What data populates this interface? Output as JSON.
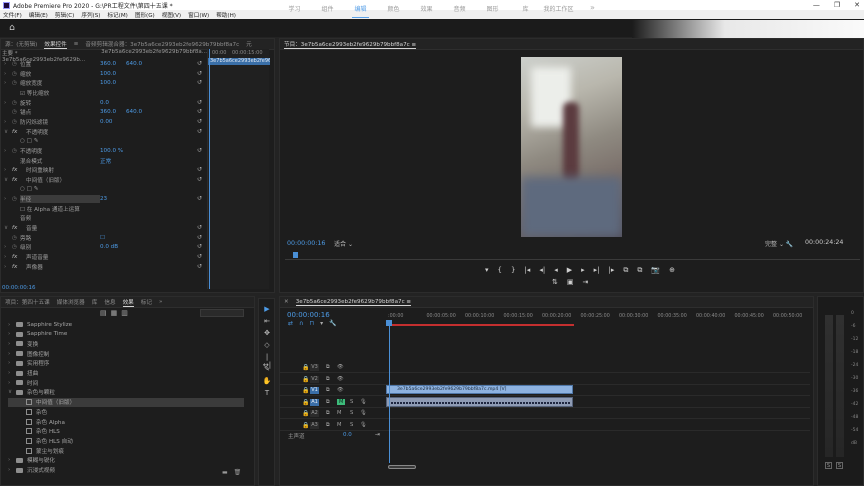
{
  "window": {
    "title": "Adobe Premiere Pro 2020 - G:\\PR工程文件\\第四十五课 *",
    "controls": [
      "—",
      "❐",
      "✕"
    ]
  },
  "menu": [
    "文件(F)",
    "编辑(E)",
    "剪辑(C)",
    "序列(S)",
    "标记(M)",
    "图形(G)",
    "视图(V)",
    "窗口(W)",
    "帮助(H)"
  ],
  "workspaces": {
    "tabs": [
      "学习",
      "组件",
      "编辑",
      "颜色",
      "效果",
      "音频",
      "图形",
      "库",
      "我的工作区"
    ],
    "active": "编辑",
    "more": "»"
  },
  "effect_controls": {
    "tabs": [
      "源：(无剪辑)",
      "效果控件",
      "≡",
      "音频剪辑混合器：3e7b5a6ce2993eb2fe9629b79bbf8a7c",
      "元"
    ],
    "source": "主要 * 3e7b5a6ce2993eb2fe9629b...",
    "clip_ref": "3e7b5a6ce2993eb2fe9629b79bbf8a...",
    "clip_bar": "3e7b5a6ce2993eb2fe9629b79bbf8a",
    "ruler_times": [
      "00:00",
      "00:00:15:00"
    ],
    "rows": [
      {
        "tw": "›",
        "sw": "◷",
        "name": "位置",
        "v1": "360.0",
        "v2": "640.0"
      },
      {
        "tw": "›",
        "sw": "◷",
        "name": "缩放",
        "v1": "100.0",
        "v2": ""
      },
      {
        "tw": "›",
        "sw": "◷",
        "name": "缩放宽度",
        "v1": "100.0",
        "v2": ""
      },
      {
        "tw": "",
        "sw": "",
        "name": "☑ 等比缩放",
        "v1": "",
        "v2": ""
      },
      {
        "tw": "›",
        "sw": "◷",
        "name": "旋转",
        "v1": "0.0",
        "v2": ""
      },
      {
        "tw": "",
        "sw": "◷",
        "name": "锚点",
        "v1": "360.0",
        "v2": "640.0"
      },
      {
        "tw": "›",
        "sw": "◷",
        "name": "防闪烁滤镜",
        "v1": "0.00",
        "v2": ""
      },
      {
        "tw": "∨",
        "sw": "fx",
        "name": "不透明度",
        "v1": "",
        "v2": ""
      },
      {
        "tw": "",
        "sw": "",
        "name": "○ □ ✎",
        "v1": "",
        "v2": ""
      },
      {
        "tw": "›",
        "sw": "◷",
        "name": "不透明度",
        "v1": "100.0 %",
        "v2": ""
      },
      {
        "tw": "",
        "sw": "",
        "name": "混合模式",
        "v1": "正常",
        "v2": ""
      },
      {
        "tw": "›",
        "sw": "fx",
        "name": "时间重映射",
        "v1": "",
        "v2": ""
      },
      {
        "tw": "∨",
        "sw": "fx",
        "name": "中间值（旧版）",
        "v1": "",
        "v2": ""
      },
      {
        "tw": "",
        "sw": "",
        "name": "○ □ ✎",
        "v1": "",
        "v2": ""
      },
      {
        "tw": "›",
        "sw": "◷",
        "name": "半径",
        "v1": "23",
        "v2": ""
      },
      {
        "tw": "",
        "sw": "",
        "name": "☐ 在 Alpha 通道上运算",
        "v1": "",
        "v2": ""
      },
      {
        "tw": "",
        "sw": "",
        "name": "音频",
        "v1": "",
        "v2": ""
      },
      {
        "tw": "∨",
        "sw": "fx",
        "name": "音量",
        "v1": "",
        "v2": ""
      },
      {
        "tw": "",
        "sw": "◷",
        "name": "旁路",
        "v1": "☐",
        "v2": ""
      },
      {
        "tw": "›",
        "sw": "◷",
        "name": "级别",
        "v1": "0.0 dB",
        "v2": ""
      },
      {
        "tw": "›",
        "sw": "fx",
        "name": "声道音量",
        "v1": "",
        "v2": ""
      },
      {
        "tw": "›",
        "sw": "fx",
        "name": "声像器",
        "v1": "",
        "v2": ""
      }
    ],
    "timecode": "00:00:00:16"
  },
  "program": {
    "title": "节目：3e7b5a6ce2993eb2fe9629b79bbf8a7c ≡",
    "timecode": "00:00:00:16",
    "fit": "适合",
    "quality": "完整",
    "duration": "00:00:24:24",
    "controls_row1": [
      "▾",
      "{",
      "}",
      "|◂",
      "◂|",
      "◂",
      "▶",
      "▸",
      "▸|",
      "|▸",
      "⧉",
      "⧉",
      "📷",
      "⊕"
    ],
    "controls_row2": [
      "⇅",
      "▣",
      "⇥"
    ]
  },
  "project": {
    "tabs": [
      "项目：第四十五课",
      "媒体浏览器",
      "库",
      "信息",
      "效果",
      "标记",
      "»"
    ],
    "tools": [
      "▤",
      "▦",
      "▥"
    ],
    "tree": [
      {
        "label": "Sapphire Stylize",
        "level": 1,
        "type": "folder"
      },
      {
        "label": "Sapphire Time",
        "level": 1,
        "type": "folder"
      },
      {
        "label": "变换",
        "level": 1,
        "type": "folder"
      },
      {
        "label": "图像控制",
        "level": 1,
        "type": "folder"
      },
      {
        "label": "实用程序",
        "level": 1,
        "type": "folder"
      },
      {
        "label": "扭曲",
        "level": 1,
        "type": "folder"
      },
      {
        "label": "时间",
        "level": 1,
        "type": "folder"
      },
      {
        "label": "杂色与颗粒",
        "level": 1,
        "type": "folder",
        "open": true
      },
      {
        "label": "中间值（旧版）",
        "level": 2,
        "type": "effect",
        "selected": true
      },
      {
        "label": "杂色",
        "level": 2,
        "type": "effect"
      },
      {
        "label": "杂色 Alpha",
        "level": 2,
        "type": "effect"
      },
      {
        "label": "杂色 HLS",
        "level": 2,
        "type": "effect"
      },
      {
        "label": "杂色 HLS 自动",
        "level": 2,
        "type": "effect"
      },
      {
        "label": "蒙尘与划痕",
        "level": 2,
        "type": "effect"
      },
      {
        "label": "模糊与锐化",
        "level": 1,
        "type": "folder"
      },
      {
        "label": "沉浸式视频",
        "level": 1,
        "type": "folder"
      }
    ],
    "footer": [
      "▬",
      "🗑"
    ]
  },
  "tools": [
    "▶",
    "⇤",
    "✥",
    "◇",
    "|↔|",
    "✎",
    "✋",
    "T"
  ],
  "timeline": {
    "tab": "3e7b5a6ce2993eb2fe9629b79bbf8a7c ≡",
    "timecode": "00:00:00:16",
    "icons": [
      "⇄",
      "∩",
      "⊓",
      "▾",
      "🔧"
    ],
    "ruler": [
      ":00:00",
      "00:00:05:00",
      "00:00:10:00",
      "00:00:15:00",
      "00:00:20:00",
      "00:00:25:00",
      "00:00:30:00",
      "00:00:35:00",
      "00:00:40:00",
      "00:00:45:00",
      "00:00:50:00"
    ],
    "tracks": [
      {
        "name": "V3",
        "kind": "video"
      },
      {
        "name": "V2",
        "kind": "video"
      },
      {
        "name": "V1",
        "kind": "video",
        "target": true
      },
      {
        "name": "A1",
        "kind": "audio",
        "target": true
      },
      {
        "name": "A2",
        "kind": "audio"
      },
      {
        "name": "A3",
        "kind": "audio"
      }
    ],
    "video_clip": "3e7b5a6ce2993eb2fe9629b79bbf8a7c.mp4 [V]",
    "master_label": "主声道",
    "master_value": "0.0"
  },
  "meters": {
    "scale": [
      "0",
      "-6",
      "-12",
      "-18",
      "-24",
      "-30",
      "-36",
      "-42",
      "-48",
      "-54",
      "dB"
    ],
    "solo": [
      "S",
      "S"
    ]
  },
  "colors": {
    "accent": "#4d9be6",
    "clip_video": "#8db2e0",
    "clip_audio": "#8e9bb4",
    "in_out": "#c42f2f"
  }
}
